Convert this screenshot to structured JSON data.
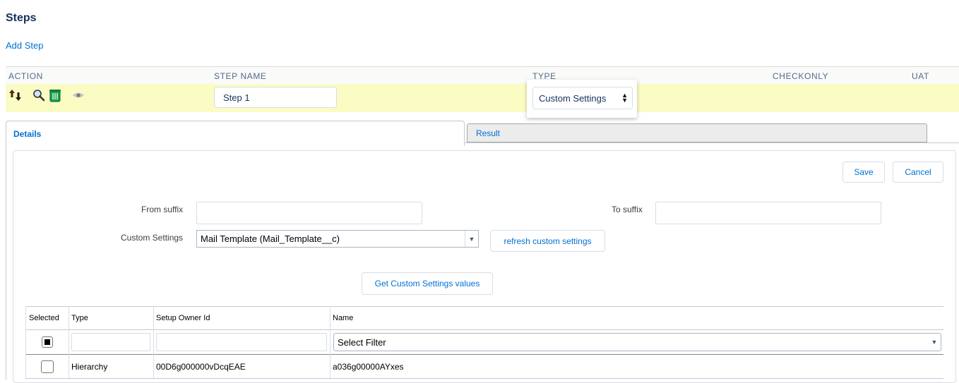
{
  "page": {
    "title": "Steps",
    "add_step_label": "Add Step"
  },
  "steps_table": {
    "columns": [
      "ACTION",
      "STEP NAME",
      "TYPE",
      "CHECKONLY",
      "UAT"
    ],
    "row": {
      "step_name": "Step 1",
      "type": "Custom Settings",
      "action_icons": [
        "move-arrows-icon",
        "magnifier-icon",
        "trash-bin-icon",
        "eye-icon"
      ]
    }
  },
  "tabs": {
    "details": "Details",
    "result": "Result"
  },
  "details": {
    "save_label": "Save",
    "cancel_label": "Cancel",
    "from_suffix_label": "From suffix",
    "from_suffix_value": "",
    "to_suffix_label": "To suffix",
    "to_suffix_value": "",
    "custom_settings_label": "Custom Settings",
    "custom_settings_value": "Mail Template (Mail_Template__c)",
    "refresh_label": "refresh custom settings",
    "get_values_label": "Get Custom Settings values"
  },
  "grid": {
    "columns": [
      "Selected",
      "Type",
      "Setup Owner Id",
      "Name"
    ],
    "filter": {
      "select_all_checked": true,
      "type": "",
      "owner": "",
      "name_filter": "Select Filter"
    },
    "rows": [
      {
        "selected": false,
        "type": "Hierarchy",
        "owner": "00D6g000000vDcqEAE",
        "name": "a036g00000AYxes"
      }
    ]
  },
  "colors": {
    "link": "#0070d2",
    "row_highlight": "#fbfbc4",
    "title": "#16325c"
  }
}
